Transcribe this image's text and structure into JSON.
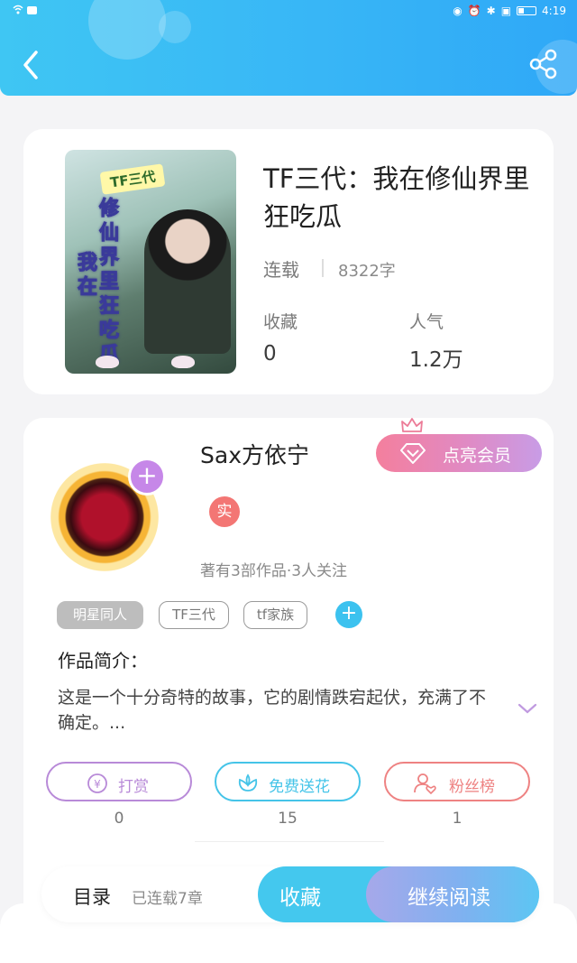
{
  "status_bar": {
    "time": "4:19"
  },
  "book": {
    "title": "TF三代：我在修仙界里狂吃瓜",
    "status": "连载",
    "word_count": "8322字",
    "stats": [
      {
        "label": "收藏",
        "value": "0"
      },
      {
        "label": "人气",
        "value": "1.2万"
      }
    ],
    "cover": {
      "tag": "TF三代",
      "text_line1": "修仙界里狂吃瓜",
      "text_line2": "我在"
    }
  },
  "author": {
    "name": "Sax方依宁",
    "vip_button": "点亮会员",
    "badge": "实",
    "stats_text": "著有3部作品·3人关注",
    "tags": [
      "明星同人",
      "TF三代",
      "tf家族"
    ]
  },
  "intro": {
    "heading": "作品简介：",
    "text": "这是一个十分奇特的故事，它的剧情跌宕起伏，充满了不确定。..."
  },
  "actions": [
    {
      "label": "打赏",
      "count": "0",
      "color": "#b88ad8",
      "icon": "coin-icon"
    },
    {
      "label": "免费送花",
      "count": "15",
      "color": "#45c4e8",
      "icon": "flower-icon"
    },
    {
      "label": "粉丝榜",
      "count": "1",
      "color": "#ee8282",
      "icon": "fan-icon"
    }
  ],
  "bottom_bar": {
    "toc_label": "目录",
    "toc_sub": "已连载7章",
    "collect_label": "收藏",
    "read_label": "继续阅读"
  }
}
